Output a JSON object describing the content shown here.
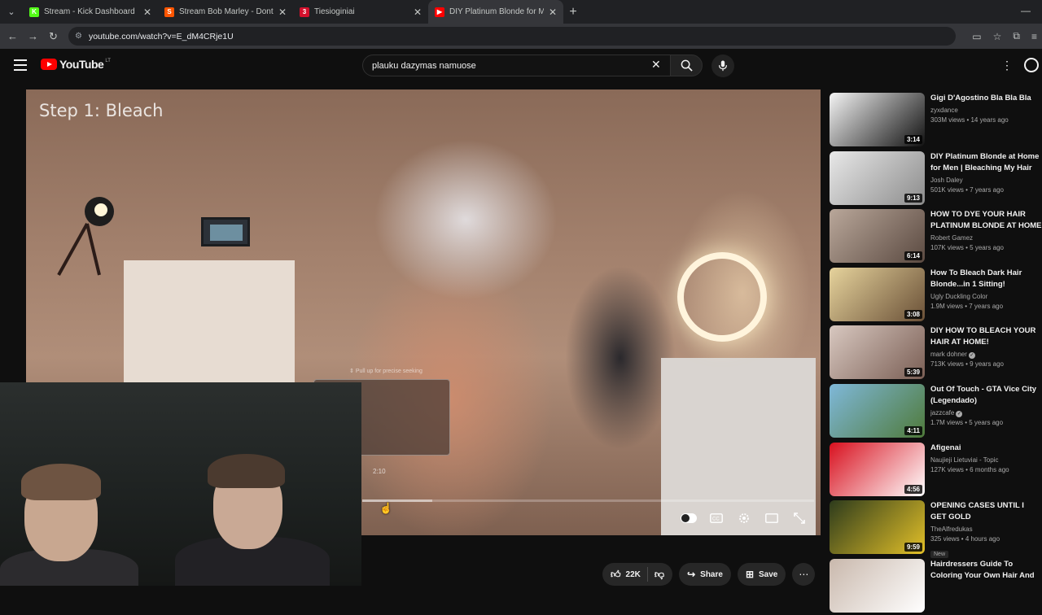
{
  "browser": {
    "tabs": [
      {
        "label": "Stream - Kick Dashboard",
        "color": "#53fc18",
        "glyph": "K"
      },
      {
        "label": "Stream Bob Marley - Dont wor",
        "color": "#ff5500",
        "glyph": "S"
      },
      {
        "label": "Tiesioginiai",
        "color": "#d4102c",
        "glyph": "3"
      },
      {
        "label": "DIY Platinum Blonde for Me",
        "color": "#ff0000",
        "glyph": "▶"
      }
    ],
    "active_tab": 3,
    "url": "youtube.com/watch?v=E_dM4CRje1U"
  },
  "youtube": {
    "logo_text": "YouTube",
    "country_code": "LT",
    "search_value": "plauku dazymas namuose"
  },
  "player": {
    "overlay_title": "Step 1: Bleach",
    "seek_hint": "⇕ Pull up for precise seeking",
    "seek_time": "2:10",
    "progress_played": 0.0,
    "progress_buffered": 0.155
  },
  "actions": {
    "likes": "22K",
    "share": "Share",
    "save": "Save"
  },
  "recommendations": [
    {
      "title": "Gigi D'Agostino Bla Bla Bla",
      "channel": "zyxdance",
      "verified": false,
      "meta": "303M views • 14 years ago",
      "duration": "3:14",
      "thumb": "#f4f4f4",
      "thumb2": "#111"
    },
    {
      "title": "DIY Platinum Blonde at Home for Men | Bleaching My Hair fo...",
      "channel": "Josh Daley",
      "verified": false,
      "meta": "501K views • 7 years ago",
      "duration": "9:13",
      "thumb": "#e8e8e8",
      "thumb2": "#8c8c8c"
    },
    {
      "title": "HOW TO DYE YOUR HAIR PLATINUM BLONDE AT HOME ...",
      "channel": "Robert Gamez",
      "verified": false,
      "meta": "107K views • 5 years ago",
      "duration": "6:14",
      "thumb": "#b9a79a",
      "thumb2": "#5b4a41"
    },
    {
      "title": "How To Bleach Dark Hair Blonde...in 1 Sitting!",
      "channel": "Ugly Duckling Color",
      "verified": false,
      "meta": "1.9M views • 7 years ago",
      "duration": "3:08",
      "thumb": "#e6d39c",
      "thumb2": "#6a5037"
    },
    {
      "title": "DIY HOW TO BLEACH YOUR HAIR AT HOME!",
      "channel": "mark dohner",
      "verified": true,
      "meta": "713K views • 9 years ago",
      "duration": "5:39",
      "thumb": "#d8c8c0",
      "thumb2": "#7a5e54"
    },
    {
      "title": "Out Of Touch - GTA Vice City (Legendado)",
      "channel": "jazzcafe",
      "verified": true,
      "meta": "1.7M views • 5 years ago",
      "duration": "4:11",
      "thumb": "#7fb8d9",
      "thumb2": "#4f7a3a"
    },
    {
      "title": "Afigenai",
      "channel": "Naujieji Lietuviai - Topic",
      "verified": false,
      "meta": "127K views • 6 months ago",
      "duration": "4:56",
      "thumb": "#d8101e",
      "thumb2": "#ffffff"
    },
    {
      "title": "OPENING CASES UNTIL I GET GOLD",
      "channel": "TheAlfredukas",
      "verified": false,
      "meta": "325 views • 4 hours ago",
      "badge": "New",
      "duration": "9:59",
      "thumb": "#2d3b1c",
      "thumb2": "#e3c028"
    },
    {
      "title": "Hairdressers Guide To Coloring Your Own Hair And Not Ruinin...",
      "channel": "",
      "verified": false,
      "meta": "",
      "duration": "",
      "thumb": "#c9b8ac",
      "thumb2": "#ffffff"
    }
  ]
}
